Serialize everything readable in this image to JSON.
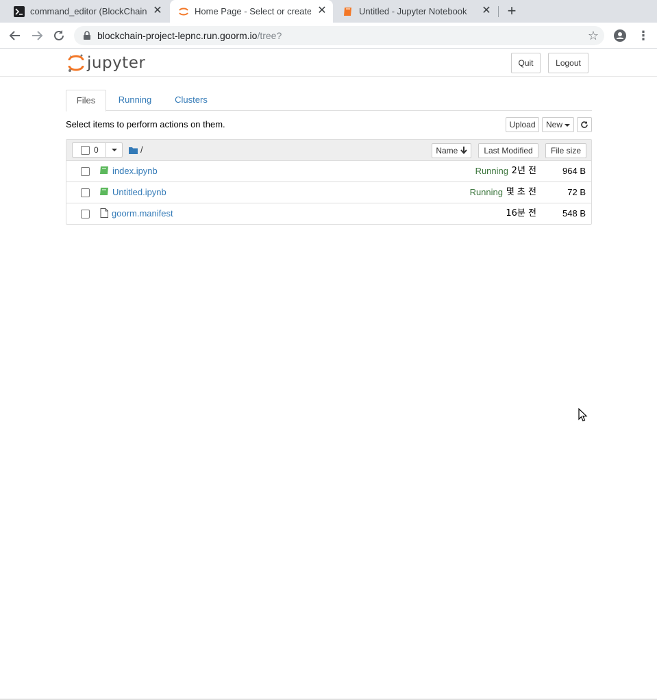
{
  "browser": {
    "tabs": [
      {
        "title": "command_editor (BlockChain_",
        "icon": "terminal-icon"
      },
      {
        "title": "Home Page - Select or create a",
        "icon": "jupyter-spinner-icon"
      },
      {
        "title": "Untitled - Jupyter Notebook",
        "icon": "notebook-icon"
      }
    ],
    "url_host": "blockchain-project-lepnc.run.goorm.io",
    "url_path": "/tree?"
  },
  "header": {
    "logo_text": "jupyter",
    "quit_label": "Quit",
    "logout_label": "Logout"
  },
  "tabs": [
    {
      "label": "Files"
    },
    {
      "label": "Running"
    },
    {
      "label": "Clusters"
    }
  ],
  "toolbar": {
    "hint": "Select items to perform actions on them.",
    "upload_label": "Upload",
    "new_label": "New"
  },
  "list": {
    "selected_count": "0",
    "breadcrumb": "/",
    "col_name": "Name",
    "col_modified": "Last Modified",
    "col_size": "File size",
    "files": [
      {
        "name": "index.ipynb",
        "status": "Running",
        "modified": "2년 전",
        "size": "964 B",
        "icon": "notebook-icon"
      },
      {
        "name": "Untitled.ipynb",
        "status": "Running",
        "modified": "몇 초 전",
        "size": "72 B",
        "icon": "notebook-icon"
      },
      {
        "name": "goorm.manifest",
        "status": "",
        "modified": "16분 전",
        "size": "548 B",
        "icon": "file-icon"
      }
    ]
  },
  "colors": {
    "link": "#337ab7",
    "running": "#3c763d",
    "jupyter_orange": "#f37726",
    "notebook_green": "#5cb85c"
  }
}
